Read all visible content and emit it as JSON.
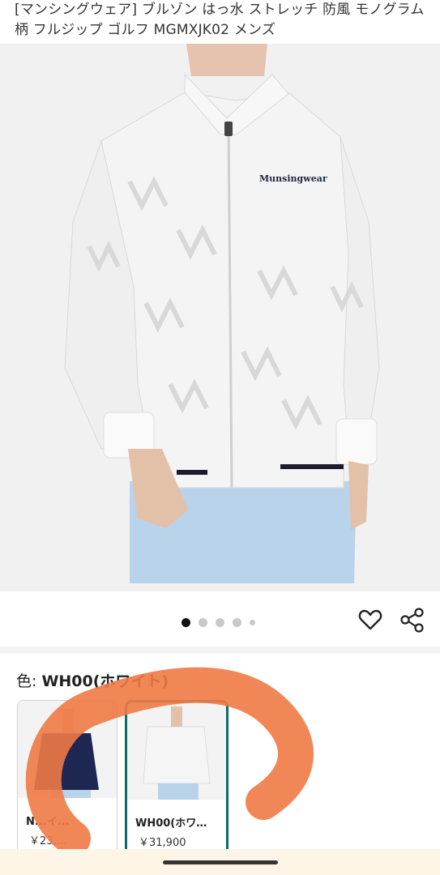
{
  "product": {
    "title": "[マンシングウェア] ブルゾン はっ水 ストレッチ 防風 モノグラム柄 フルジップ ゴルフ MGMXJK02 メンズ",
    "brand_on_garment": "Munsingwear"
  },
  "gallery": {
    "dot_count": 5,
    "active_index": 0
  },
  "actions": {
    "favorite_icon": "heart-outline-icon",
    "share_icon": "share-icon"
  },
  "color": {
    "label": "色: ",
    "selected": "WH00(ホワイト)"
  },
  "swatches": [
    {
      "name": "N...イ...",
      "price": "￥23,..."
    },
    {
      "name": "WH00(ホワ…",
      "price": "￥31,900"
    }
  ],
  "colors": {
    "accent": "#0f6a6b",
    "scribble": "#f07a45"
  }
}
